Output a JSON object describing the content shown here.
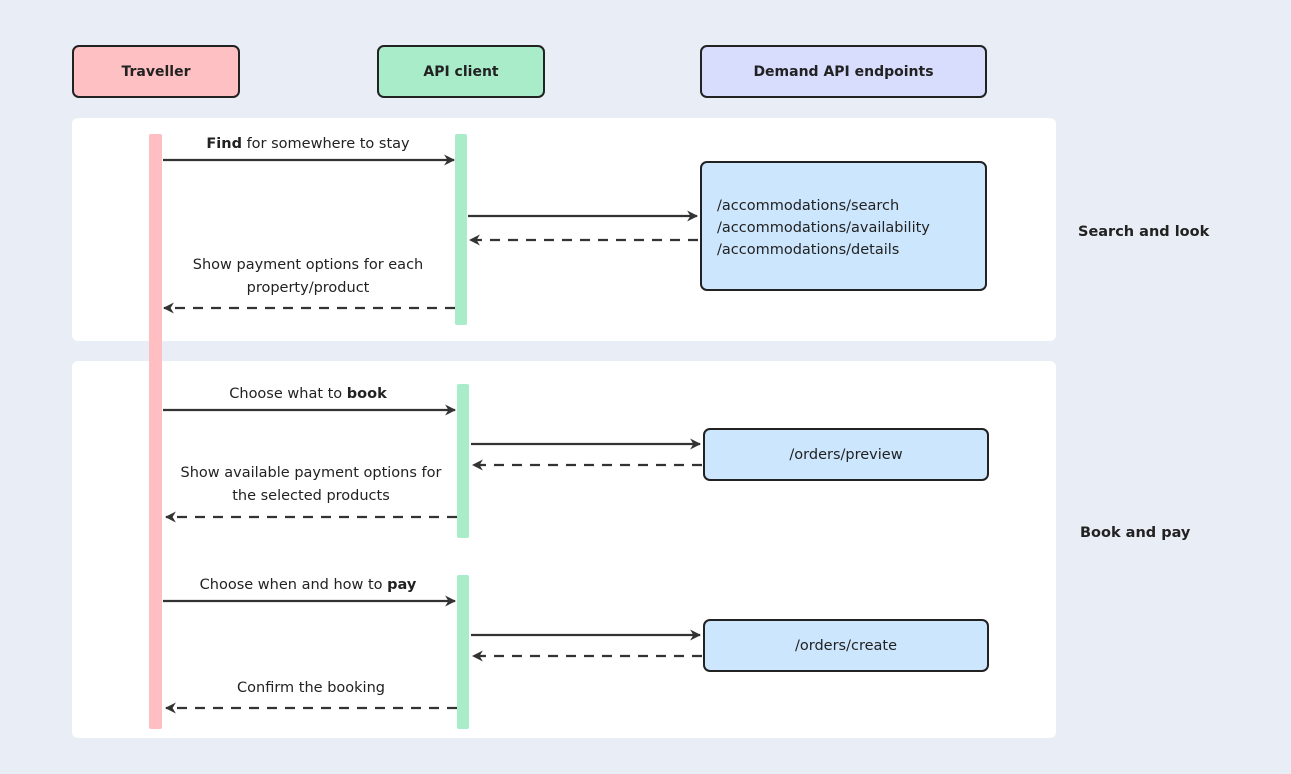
{
  "actors": [
    {
      "label": "Traveller",
      "color": "#ffc0c3"
    },
    {
      "label": "API client",
      "color": "#a8ecc9"
    },
    {
      "label": "Demand API endpoints",
      "color": "#d8dcfd"
    }
  ],
  "sections": [
    {
      "label": "Search and look"
    },
    {
      "label": "Book and pay"
    }
  ],
  "messages": {
    "find": {
      "bold": "Find",
      "rest": " for somewhere to stay"
    },
    "show_payment": {
      "line1": "Show payment options for each",
      "line2": "property/product"
    },
    "choose_book": {
      "pre": "Choose what to ",
      "bold": "book"
    },
    "show_available": {
      "line1": "Show available payment options for",
      "line2": "the selected products"
    },
    "choose_pay": {
      "pre": "Choose when and how to ",
      "bold": "pay"
    },
    "confirm": {
      "text": "Confirm the booking"
    }
  },
  "endpoints": {
    "search_group": [
      "/accommodations/search",
      "/accommodations/availability",
      "/accommodations/details"
    ],
    "preview": "/orders/preview",
    "create": "/orders/create"
  },
  "colors": {
    "background": "#e9edf5",
    "endpoint_fill": "#cce6fe",
    "arrow": "#333333"
  }
}
